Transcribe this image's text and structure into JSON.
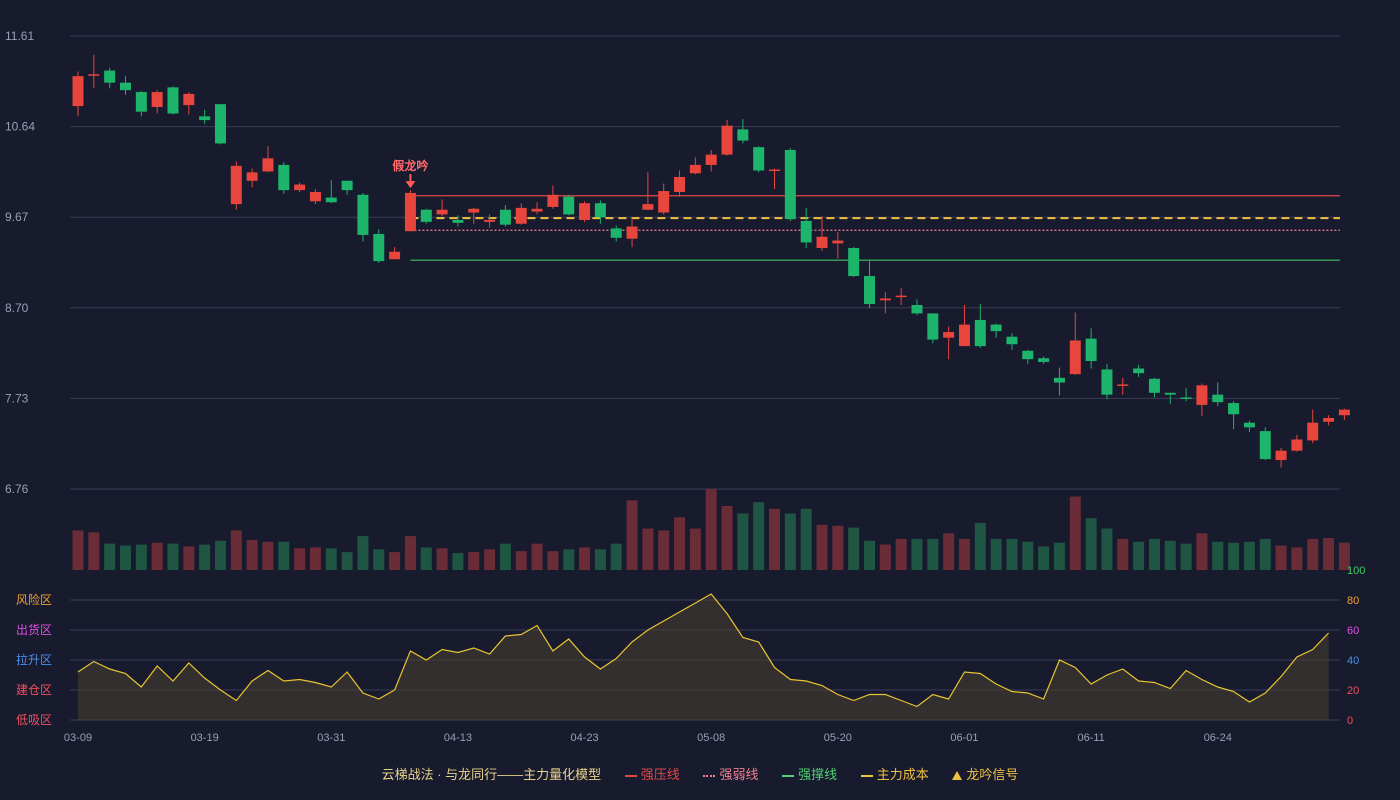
{
  "chart_data": [
    {
      "type": "candlestick",
      "title": "",
      "ylim": [
        6.76,
        11.61
      ],
      "y_ticks": [
        "11.61",
        "10.64",
        "9.67",
        "8.70",
        "7.73",
        "6.76"
      ],
      "x_tick_labels": [
        {
          "i": 0,
          "label": "03-09"
        },
        {
          "i": 8,
          "label": "03-19"
        },
        {
          "i": 16,
          "label": "03-31"
        },
        {
          "i": 24,
          "label": "04-13"
        },
        {
          "i": 32,
          "label": "04-23"
        },
        {
          "i": 40,
          "label": "05-08"
        },
        {
          "i": 48,
          "label": "05-20"
        },
        {
          "i": 56,
          "label": "06-01"
        },
        {
          "i": 64,
          "label": "06-11"
        },
        {
          "i": 72,
          "label": "06-24"
        }
      ],
      "candles": [
        [
          10.86,
          11.18,
          11.23,
          10.75
        ],
        [
          11.2,
          11.2,
          11.41,
          11.05
        ],
        [
          11.24,
          11.11,
          11.27,
          11.05
        ],
        [
          11.11,
          11.03,
          11.18,
          10.98
        ],
        [
          11.01,
          10.8,
          11.02,
          10.75
        ],
        [
          10.85,
          11.01,
          11.03,
          10.78
        ],
        [
          11.06,
          10.78,
          11.07,
          10.77
        ],
        [
          10.87,
          10.99,
          11.01,
          10.77
        ],
        [
          10.75,
          10.71,
          10.82,
          10.67
        ],
        [
          10.88,
          10.46,
          10.88,
          10.45
        ],
        [
          9.81,
          10.22,
          10.27,
          9.75
        ],
        [
          10.06,
          10.15,
          10.19,
          9.99
        ],
        [
          10.16,
          10.3,
          10.43,
          10.15
        ],
        [
          10.23,
          9.96,
          10.26,
          9.92
        ],
        [
          9.96,
          10.02,
          10.04,
          9.94
        ],
        [
          9.84,
          9.94,
          9.97,
          9.81
        ],
        [
          9.88,
          9.83,
          10.07,
          9.82
        ],
        [
          10.06,
          9.96,
          10.06,
          9.91
        ],
        [
          9.91,
          9.48,
          9.93,
          9.41
        ],
        [
          9.49,
          9.2,
          9.54,
          9.18
        ],
        [
          9.22,
          9.3,
          9.35,
          9.22
        ],
        [
          9.52,
          9.93,
          9.96,
          9.52
        ],
        [
          9.75,
          9.62,
          9.76,
          9.6
        ],
        [
          9.7,
          9.75,
          9.86,
          9.68
        ],
        [
          9.64,
          9.61,
          9.69,
          9.57
        ],
        [
          9.72,
          9.76,
          9.77,
          9.6
        ],
        [
          9.62,
          9.64,
          9.7,
          9.56
        ],
        [
          9.75,
          9.59,
          9.8,
          9.57
        ],
        [
          9.6,
          9.77,
          9.82,
          9.59
        ],
        [
          9.73,
          9.76,
          9.83,
          9.7
        ],
        [
          9.78,
          9.91,
          10.01,
          9.76
        ],
        [
          9.89,
          9.7,
          9.91,
          9.69
        ],
        [
          9.64,
          9.82,
          9.84,
          9.62
        ],
        [
          9.82,
          9.67,
          9.85,
          9.6
        ],
        [
          9.55,
          9.45,
          9.58,
          9.41
        ],
        [
          9.44,
          9.57,
          9.66,
          9.35
        ],
        [
          9.75,
          9.81,
          10.15,
          9.75
        ],
        [
          9.72,
          9.95,
          10.03,
          9.7
        ],
        [
          9.94,
          10.1,
          10.17,
          9.89
        ],
        [
          10.14,
          10.23,
          10.31,
          10.13
        ],
        [
          10.23,
          10.34,
          10.39,
          10.16
        ],
        [
          10.34,
          10.65,
          10.71,
          10.33
        ],
        [
          10.61,
          10.49,
          10.72,
          10.46
        ],
        [
          10.42,
          10.17,
          10.43,
          10.15
        ],
        [
          10.17,
          10.18,
          10.19,
          9.97
        ],
        [
          10.39,
          9.65,
          10.41,
          9.63
        ],
        [
          9.63,
          9.4,
          9.77,
          9.34
        ],
        [
          9.34,
          9.46,
          9.68,
          9.31
        ],
        [
          9.39,
          9.42,
          9.51,
          9.23
        ],
        [
          9.34,
          9.04,
          9.35,
          9.03
        ],
        [
          9.04,
          8.74,
          9.2,
          8.7
        ],
        [
          8.78,
          8.8,
          8.87,
          8.64
        ],
        [
          8.82,
          8.83,
          8.91,
          8.73
        ],
        [
          8.73,
          8.64,
          8.79,
          8.62
        ],
        [
          8.64,
          8.36,
          8.64,
          8.32
        ],
        [
          8.38,
          8.44,
          8.5,
          8.15
        ],
        [
          8.29,
          8.52,
          8.73,
          8.29
        ],
        [
          8.57,
          8.29,
          8.74,
          8.27
        ],
        [
          8.52,
          8.45,
          8.53,
          8.38
        ],
        [
          8.39,
          8.31,
          8.43,
          8.25
        ],
        [
          8.24,
          8.15,
          8.25,
          8.1
        ],
        [
          8.16,
          8.12,
          8.18,
          8.1
        ],
        [
          7.95,
          7.9,
          8.06,
          7.76
        ],
        [
          7.99,
          8.35,
          8.65,
          7.98
        ],
        [
          8.37,
          8.13,
          8.48,
          8.05
        ],
        [
          8.04,
          7.77,
          8.1,
          7.72
        ],
        [
          7.88,
          7.88,
          7.95,
          7.77
        ],
        [
          8.05,
          8.0,
          8.09,
          7.96
        ],
        [
          7.94,
          7.79,
          7.95,
          7.74
        ],
        [
          7.79,
          7.77,
          7.79,
          7.67
        ],
        [
          7.74,
          7.73,
          7.84,
          7.7
        ],
        [
          7.66,
          7.87,
          7.89,
          7.54
        ],
        [
          7.77,
          7.69,
          7.9,
          7.65
        ],
        [
          7.68,
          7.56,
          7.7,
          7.4
        ],
        [
          7.47,
          7.42,
          7.49,
          7.37
        ],
        [
          7.38,
          7.08,
          7.42,
          7.07
        ],
        [
          7.07,
          7.17,
          7.2,
          6.99
        ],
        [
          7.17,
          7.29,
          7.34,
          7.16
        ],
        [
          7.28,
          7.47,
          7.61,
          7.25
        ],
        [
          7.48,
          7.52,
          7.55,
          7.44
        ],
        [
          7.55,
          7.61,
          7.62,
          7.5
        ]
      ],
      "lines": [
        {
          "label": "强压线",
          "value": 9.9,
          "from_index": 21,
          "style": "solid",
          "color": "#e04848"
        },
        {
          "label": "强弱线",
          "value": 9.53,
          "from_index": 21,
          "style": "dotted",
          "color": "#f08090"
        },
        {
          "label": "主力成本",
          "value": 9.66,
          "from_index": 21,
          "style": "dashed",
          "color": "#f0c040"
        },
        {
          "label": "强撑线",
          "value": 9.21,
          "from_index": 21,
          "style": "solid",
          "color": "#40c060"
        }
      ],
      "annotations": [
        {
          "index": 21,
          "text": "假龙吟"
        }
      ]
    },
    {
      "type": "bar",
      "name": "volume",
      "values": [
        42,
        40,
        28,
        26,
        27,
        29,
        28,
        25,
        27,
        31,
        42,
        32,
        30,
        30,
        23,
        24,
        23,
        19,
        36,
        22,
        19,
        36,
        24,
        23,
        18,
        19,
        22,
        28,
        20,
        28,
        20,
        22,
        24,
        22,
        28,
        74,
        44,
        42,
        56,
        44,
        86,
        68,
        60,
        72,
        65,
        60,
        65,
        48,
        47,
        45,
        31,
        27,
        33,
        33,
        33,
        39,
        33,
        50,
        33,
        33,
        30,
        25,
        29,
        78,
        55,
        44,
        33,
        30,
        33,
        31,
        28,
        39,
        30,
        29,
        30,
        33,
        26,
        24,
        33,
        34,
        29
      ]
    },
    {
      "type": "area",
      "ylim": [
        0,
        100
      ],
      "y_ticks": [
        "100",
        "80",
        "60",
        "40",
        "20",
        "0"
      ],
      "zone_labels": [
        "风险区",
        "出货区",
        "拉升区",
        "建仓区",
        "低吸区"
      ],
      "values": [
        32,
        39,
        34,
        31,
        22,
        36,
        26,
        38,
        28,
        20,
        13,
        26,
        33,
        26,
        27,
        25,
        22,
        32,
        18,
        14,
        20,
        46,
        40,
        47,
        45,
        48,
        44,
        56,
        57,
        63,
        46,
        54,
        42,
        34,
        41,
        52,
        60,
        66,
        72,
        78,
        84,
        71,
        55,
        52,
        35,
        27,
        26,
        23,
        17,
        13,
        17,
        17,
        13,
        9,
        17,
        14,
        32,
        31,
        24,
        19,
        18,
        14,
        40,
        35,
        24,
        30,
        34,
        26,
        25,
        21,
        33,
        27,
        22,
        19,
        12,
        18,
        29,
        42,
        47,
        58
      ]
    }
  ],
  "legend": {
    "title": "云梯战法 · 与龙同行——主力量化模型",
    "items": [
      "强压线",
      "强弱线",
      "强撑线",
      "主力成本",
      "龙吟信号"
    ]
  },
  "colors": {
    "up": "#e8463c",
    "down": "#1db46b",
    "volume_up": "#6a2c37",
    "volume_down": "#1f5543",
    "area_line": "#e8c530",
    "grid": "#3a3d55",
    "zone_risk": "#f0a030",
    "zone_distribute": "#e050e0",
    "zone_rise": "#4a90e8",
    "zone_build": "#f05060",
    "zone_low": "#f05060"
  }
}
